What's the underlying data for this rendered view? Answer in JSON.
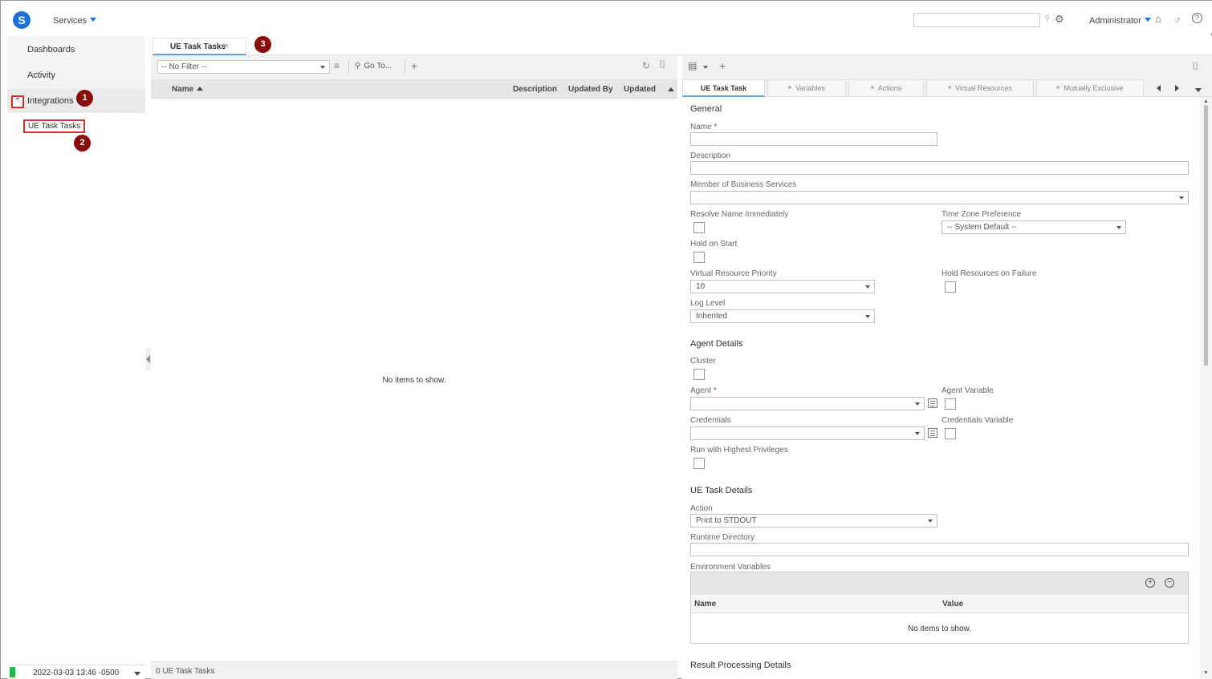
{
  "topbar": {
    "logo_letter": "S",
    "services_label": "Services",
    "search_placeholder": "",
    "user_label": "Administrator",
    "help_glyph": "?"
  },
  "sidebar": {
    "items": [
      {
        "label": "Dashboards"
      },
      {
        "label": "Activity"
      },
      {
        "label": "Integrations",
        "expanded": true
      }
    ],
    "subitems": [
      {
        "label": "UE Task Tasks"
      }
    ],
    "datetime": "2022-03-03 13:46 -0500",
    "status_color": "#2fb24f"
  },
  "annotations": [
    "1",
    "2",
    "3"
  ],
  "tabs": [
    {
      "label": "UE Task Tasks",
      "close": "×"
    }
  ],
  "list": {
    "filter_value": "-- No Filter --",
    "goto_label": "Go To...",
    "columns": [
      "Name",
      "Description",
      "Updated By",
      "Updated"
    ],
    "sorted_by": "Name",
    "empty_message": "No items to show.",
    "footer_count": "0 UE Task Tasks"
  },
  "detail": {
    "tabs": [
      {
        "label": "UE Task Task",
        "active": true
      },
      {
        "label": "Variables"
      },
      {
        "label": "Actions"
      },
      {
        "label": "Virtual Resources"
      },
      {
        "label": "Mutually Exclusive"
      }
    ],
    "sections": {
      "general": "General",
      "agent_details": "Agent Details",
      "ue_task_details": "UE Task Details",
      "result_processing": "Result Processing Details"
    },
    "fields": {
      "name_label": "Name",
      "description_label": "Description",
      "member_label": "Member of Business Services",
      "resolve_label": "Resolve Name Immediately",
      "tz_label": "Time Zone Preference",
      "tz_value": "-- System Default --",
      "hold_label": "Hold on Start",
      "vrp_label": "Virtual Resource Priority",
      "vrp_value": "10",
      "hold_res_label": "Hold Resources on Failure",
      "log_label": "Log Level",
      "log_value": "Inherited",
      "cluster_label": "Cluster",
      "agent_label": "Agent",
      "agent_var_label": "Agent Variable",
      "cred_label": "Credentials",
      "cred_var_label": "Credentials Variable",
      "run_high_label": "Run with Highest Privileges",
      "action_label": "Action",
      "action_value": "Print to STDOUT",
      "runtime_dir_label": "Runtime Directory",
      "env_label": "Environment Variables"
    },
    "env_table": {
      "columns": [
        "Name",
        "Value"
      ],
      "empty_message": "No items to show."
    },
    "required_marker": "*"
  },
  "colors": {
    "accent": "#1e6fd9",
    "annotation_badge": "#8b0b0b",
    "annotation_box": "#d62e2e",
    "tab_underline": "#5aa0e6"
  }
}
